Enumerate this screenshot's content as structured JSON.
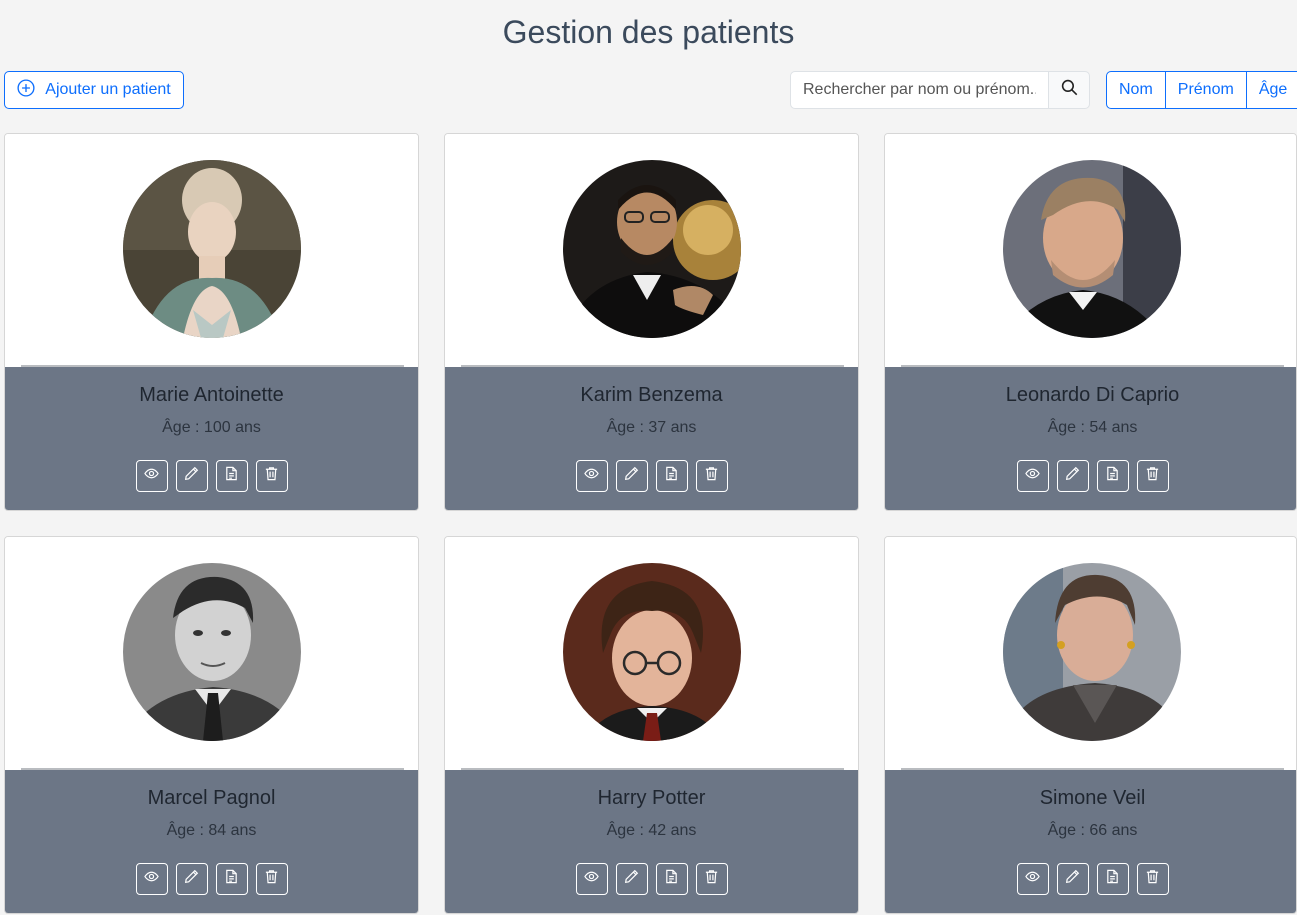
{
  "header": {
    "title": "Gestion des patients"
  },
  "toolbar": {
    "add_label": "Ajouter un patient",
    "search_placeholder": "Rechercher par nom ou prénom...",
    "sort_options": [
      "Nom",
      "Prénom",
      "Âge"
    ]
  },
  "colors": {
    "accent": "#0d6efd",
    "card_body": "#6c7686",
    "page_bg": "#f4f4f4",
    "title": "#3b4a5c"
  },
  "patients": [
    {
      "name": "Marie Antoinette",
      "age": "Âge : 100 ans",
      "photo": "portrait-painting"
    },
    {
      "name": "Karim Benzema",
      "age": "Âge : 37 ans",
      "photo": "portrait-photo"
    },
    {
      "name": "Leonardo Di Caprio",
      "age": "Âge : 54 ans",
      "photo": "portrait-photo"
    },
    {
      "name": "Marcel Pagnol",
      "age": "Âge : 84 ans",
      "photo": "portrait-bw-photo"
    },
    {
      "name": "Harry Potter",
      "age": "Âge : 42 ans",
      "photo": "portrait-photo"
    },
    {
      "name": "Simone Veil",
      "age": "Âge : 66 ans",
      "photo": "portrait-photo"
    }
  ],
  "card_actions": [
    "eye-icon",
    "pencil-icon",
    "document-icon",
    "trash-icon"
  ]
}
